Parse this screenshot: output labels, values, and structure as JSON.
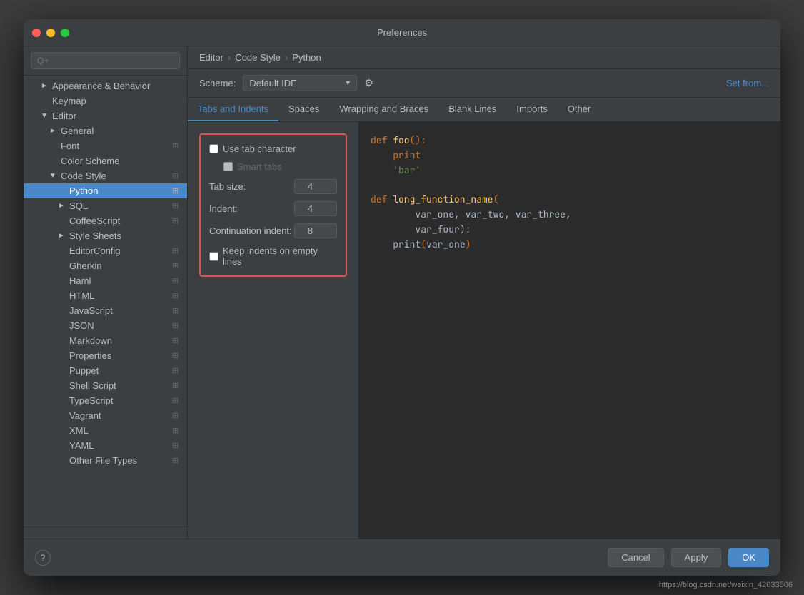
{
  "window": {
    "title": "Preferences"
  },
  "breadcrumb": {
    "parts": [
      "Editor",
      "Code Style",
      "Python"
    ],
    "sep": "›"
  },
  "scheme": {
    "label": "Scheme:",
    "value": "Default  IDE",
    "set_from": "Set from..."
  },
  "tabs": [
    {
      "id": "tabs-indents",
      "label": "Tabs and Indents",
      "active": true
    },
    {
      "id": "spaces",
      "label": "Spaces"
    },
    {
      "id": "wrapping",
      "label": "Wrapping and Braces"
    },
    {
      "id": "blank-lines",
      "label": "Blank Lines"
    },
    {
      "id": "imports",
      "label": "Imports"
    },
    {
      "id": "other",
      "label": "Other"
    }
  ],
  "settings": {
    "use_tab_character": {
      "label": "Use tab character",
      "checked": false
    },
    "smart_tabs": {
      "label": "Smart tabs",
      "checked": false,
      "disabled": true
    },
    "tab_size": {
      "label": "Tab size:",
      "value": 4
    },
    "indent": {
      "label": "Indent:",
      "value": 4
    },
    "continuation_indent": {
      "label": "Continuation indent:",
      "value": 8
    },
    "keep_indents": {
      "label": "Keep indents on empty lines",
      "checked": false
    }
  },
  "sidebar": {
    "search_placeholder": "Q+",
    "items": [
      {
        "id": "appearance",
        "label": "Appearance & Behavior",
        "level": 0,
        "arrow": "►",
        "selected": false
      },
      {
        "id": "keymap",
        "label": "Keymap",
        "level": 0,
        "arrow": "",
        "selected": false
      },
      {
        "id": "editor",
        "label": "Editor",
        "level": 0,
        "arrow": "▼",
        "selected": false
      },
      {
        "id": "general",
        "label": "General",
        "level": 1,
        "arrow": "►",
        "selected": false
      },
      {
        "id": "font",
        "label": "Font",
        "level": 1,
        "arrow": "",
        "selected": false
      },
      {
        "id": "color-scheme",
        "label": "Color Scheme",
        "level": 1,
        "arrow": "",
        "selected": false
      },
      {
        "id": "code-style",
        "label": "Code Style",
        "level": 1,
        "arrow": "▼",
        "selected": false
      },
      {
        "id": "python",
        "label": "Python",
        "level": 2,
        "arrow": "",
        "selected": true
      },
      {
        "id": "sql",
        "label": "SQL",
        "level": 2,
        "arrow": "►",
        "selected": false
      },
      {
        "id": "coffeescript",
        "label": "CoffeeScript",
        "level": 2,
        "arrow": "",
        "selected": false
      },
      {
        "id": "style-sheets",
        "label": "Style Sheets",
        "level": 2,
        "arrow": "►",
        "selected": false
      },
      {
        "id": "editorconfig",
        "label": "EditorConfig",
        "level": 2,
        "arrow": "",
        "selected": false
      },
      {
        "id": "gherkin",
        "label": "Gherkin",
        "level": 2,
        "arrow": "",
        "selected": false
      },
      {
        "id": "haml",
        "label": "Haml",
        "level": 2,
        "arrow": "",
        "selected": false
      },
      {
        "id": "html",
        "label": "HTML",
        "level": 2,
        "arrow": "",
        "selected": false
      },
      {
        "id": "javascript",
        "label": "JavaScript",
        "level": 2,
        "arrow": "",
        "selected": false
      },
      {
        "id": "json",
        "label": "JSON",
        "level": 2,
        "arrow": "",
        "selected": false
      },
      {
        "id": "markdown",
        "label": "Markdown",
        "level": 2,
        "arrow": "",
        "selected": false
      },
      {
        "id": "properties",
        "label": "Properties",
        "level": 2,
        "arrow": "",
        "selected": false
      },
      {
        "id": "puppet",
        "label": "Puppet",
        "level": 2,
        "arrow": "",
        "selected": false
      },
      {
        "id": "shell-script",
        "label": "Shell Script",
        "level": 2,
        "arrow": "",
        "selected": false
      },
      {
        "id": "typescript",
        "label": "TypeScript",
        "level": 2,
        "arrow": "",
        "selected": false
      },
      {
        "id": "vagrant",
        "label": "Vagrant",
        "level": 2,
        "arrow": "",
        "selected": false
      },
      {
        "id": "xml",
        "label": "XML",
        "level": 2,
        "arrow": "",
        "selected": false
      },
      {
        "id": "yaml",
        "label": "YAML",
        "level": 2,
        "arrow": "",
        "selected": false
      },
      {
        "id": "other-file-types",
        "label": "Other File Types",
        "level": 2,
        "arrow": "",
        "selected": false
      }
    ]
  },
  "buttons": {
    "cancel": "Cancel",
    "apply": "Apply",
    "ok": "OK",
    "help": "?"
  },
  "code_preview": [
    {
      "tokens": [
        {
          "type": "kw",
          "text": "def "
        },
        {
          "type": "fn",
          "text": "foo"
        },
        {
          "type": "punc",
          "text": "():"
        }
      ]
    },
    {
      "tokens": [
        {
          "type": "plain",
          "text": "    "
        },
        {
          "type": "kw",
          "text": "print"
        }
      ]
    },
    {
      "tokens": [
        {
          "type": "plain",
          "text": "    "
        },
        {
          "type": "str",
          "text": "'bar'"
        }
      ]
    },
    {
      "tokens": []
    },
    {
      "tokens": [
        {
          "type": "kw",
          "text": "def "
        },
        {
          "type": "fn",
          "text": "long_function_name"
        },
        {
          "type": "punc",
          "text": "("
        }
      ]
    },
    {
      "tokens": [
        {
          "type": "plain",
          "text": "        var_one, var_two, var_three,"
        }
      ]
    },
    {
      "tokens": [
        {
          "type": "plain",
          "text": "        var_four):"
        }
      ]
    },
    {
      "tokens": [
        {
          "type": "plain",
          "text": "    "
        },
        {
          "type": "plain",
          "text": "print"
        },
        {
          "type": "punc",
          "text": "("
        },
        {
          "type": "plain",
          "text": "var_one"
        },
        {
          "type": "punc",
          "text": ")"
        }
      ]
    }
  ],
  "watermark": "https://blog.csdn.net/weixin_42033506"
}
